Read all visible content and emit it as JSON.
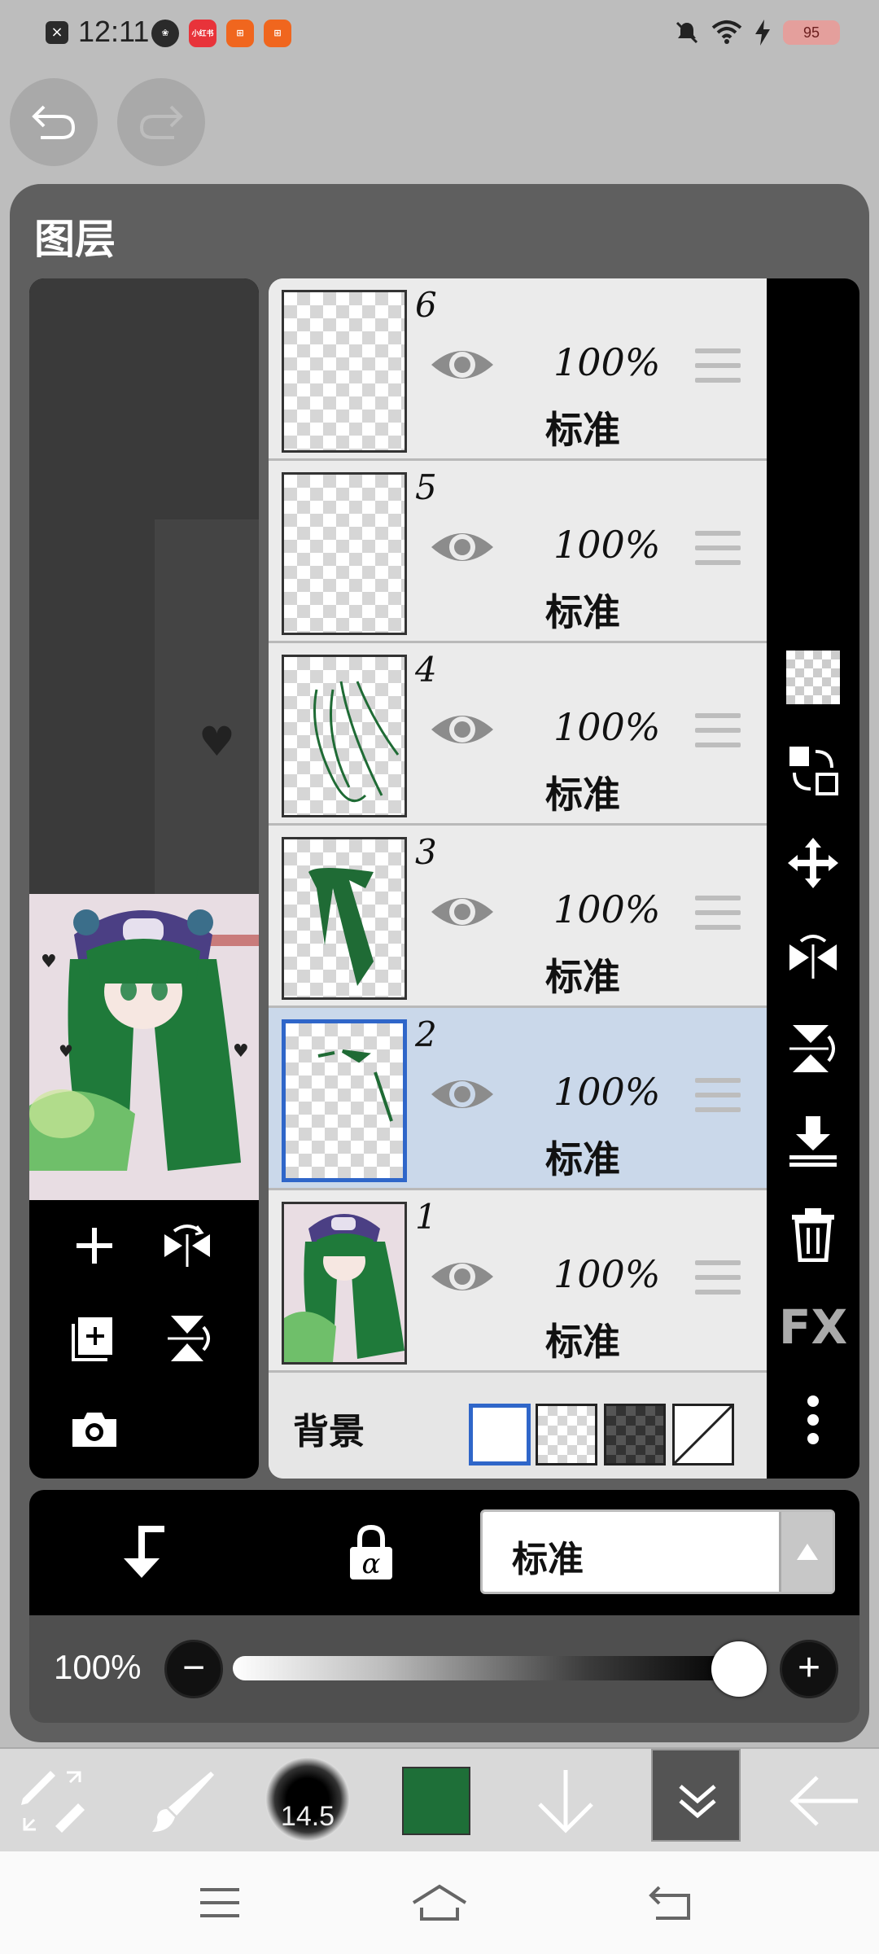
{
  "status_bar": {
    "time": "12:11",
    "apps": [
      {
        "name": "flower-app",
        "color": "#2a2a2a",
        "label": ""
      },
      {
        "name": "xiaohongshu-app",
        "color": "#e8333a",
        "label": "小红书"
      },
      {
        "name": "app-orange-1",
        "color": "#f0661e",
        "label": ""
      },
      {
        "name": "app-orange-2",
        "color": "#f0661e",
        "label": ""
      }
    ],
    "battery": "95"
  },
  "dialog": {
    "title": "图层"
  },
  "layers": [
    {
      "number": "6",
      "opacity": "100%",
      "mode": "标准",
      "selected": false,
      "thumb": "empty"
    },
    {
      "number": "5",
      "opacity": "100%",
      "mode": "标准",
      "selected": false,
      "thumb": "empty"
    },
    {
      "number": "4",
      "opacity": "100%",
      "mode": "标准",
      "selected": false,
      "thumb": "hair-lines"
    },
    {
      "number": "3",
      "opacity": "100%",
      "mode": "标准",
      "selected": false,
      "thumb": "hair-fill"
    },
    {
      "number": "2",
      "opacity": "100%",
      "mode": "标准",
      "selected": true,
      "thumb": "small-marks"
    },
    {
      "number": "1",
      "opacity": "100%",
      "mode": "标准",
      "selected": false,
      "thumb": "character"
    }
  ],
  "background": {
    "label": "背景"
  },
  "right_tools": {
    "fx_label": "FX"
  },
  "blend": {
    "mode": "标准"
  },
  "opacity": {
    "label": "100%",
    "value": 1.0
  },
  "toolbar": {
    "brush_size": "14.5",
    "color": "#1e6f38"
  },
  "colors": {
    "selected_layer": "#cad8ea",
    "selection_border": "#2f66c9",
    "dialog_bg": "#5f5f5f",
    "hair_green": "#1f6b35"
  }
}
